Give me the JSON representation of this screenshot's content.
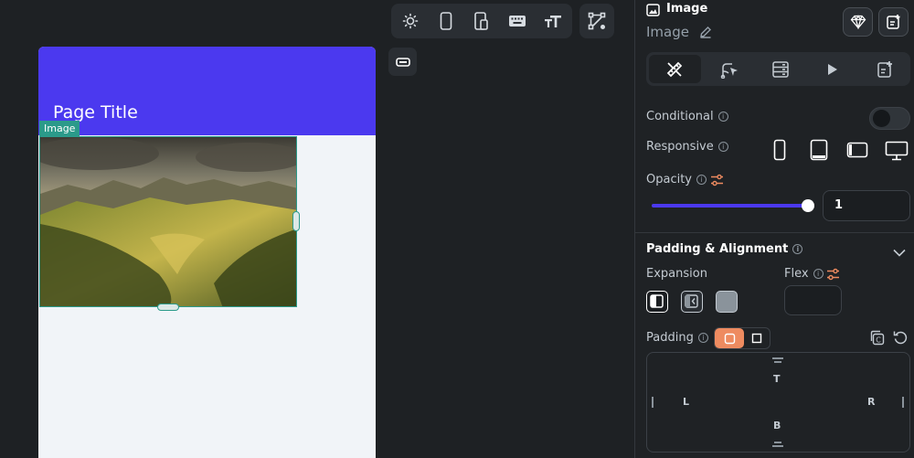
{
  "canvas": {
    "page_title": "Page Title",
    "selection_tag": "Image",
    "toolbar_icons": [
      "sun-icon",
      "phone-icon",
      "tablet-phone-icon",
      "keyboard-icon",
      "font-size-icon",
      "vector-path-icon"
    ]
  },
  "panel": {
    "header_title": "Image",
    "widget_name": "Image",
    "tabs": [
      "properties-tab",
      "actions-tab",
      "backend-query-tab",
      "animations-tab",
      "docs-tab"
    ],
    "conditional_label": "Conditional",
    "responsive_label": "Responsive",
    "opacity_label": "Opacity",
    "opacity_value": "1",
    "opacity_fraction": 1.0,
    "section_title": "Padding & Alignment",
    "expansion_label": "Expansion",
    "flex_label": "Flex",
    "padding_label": "Padding",
    "pad_top": "T",
    "pad_left": "L",
    "pad_right": "R",
    "pad_bottom": "B"
  },
  "colors": {
    "primary": "#4b39ef",
    "selection": "#2b9a8a",
    "accent": "#ee8b60"
  }
}
